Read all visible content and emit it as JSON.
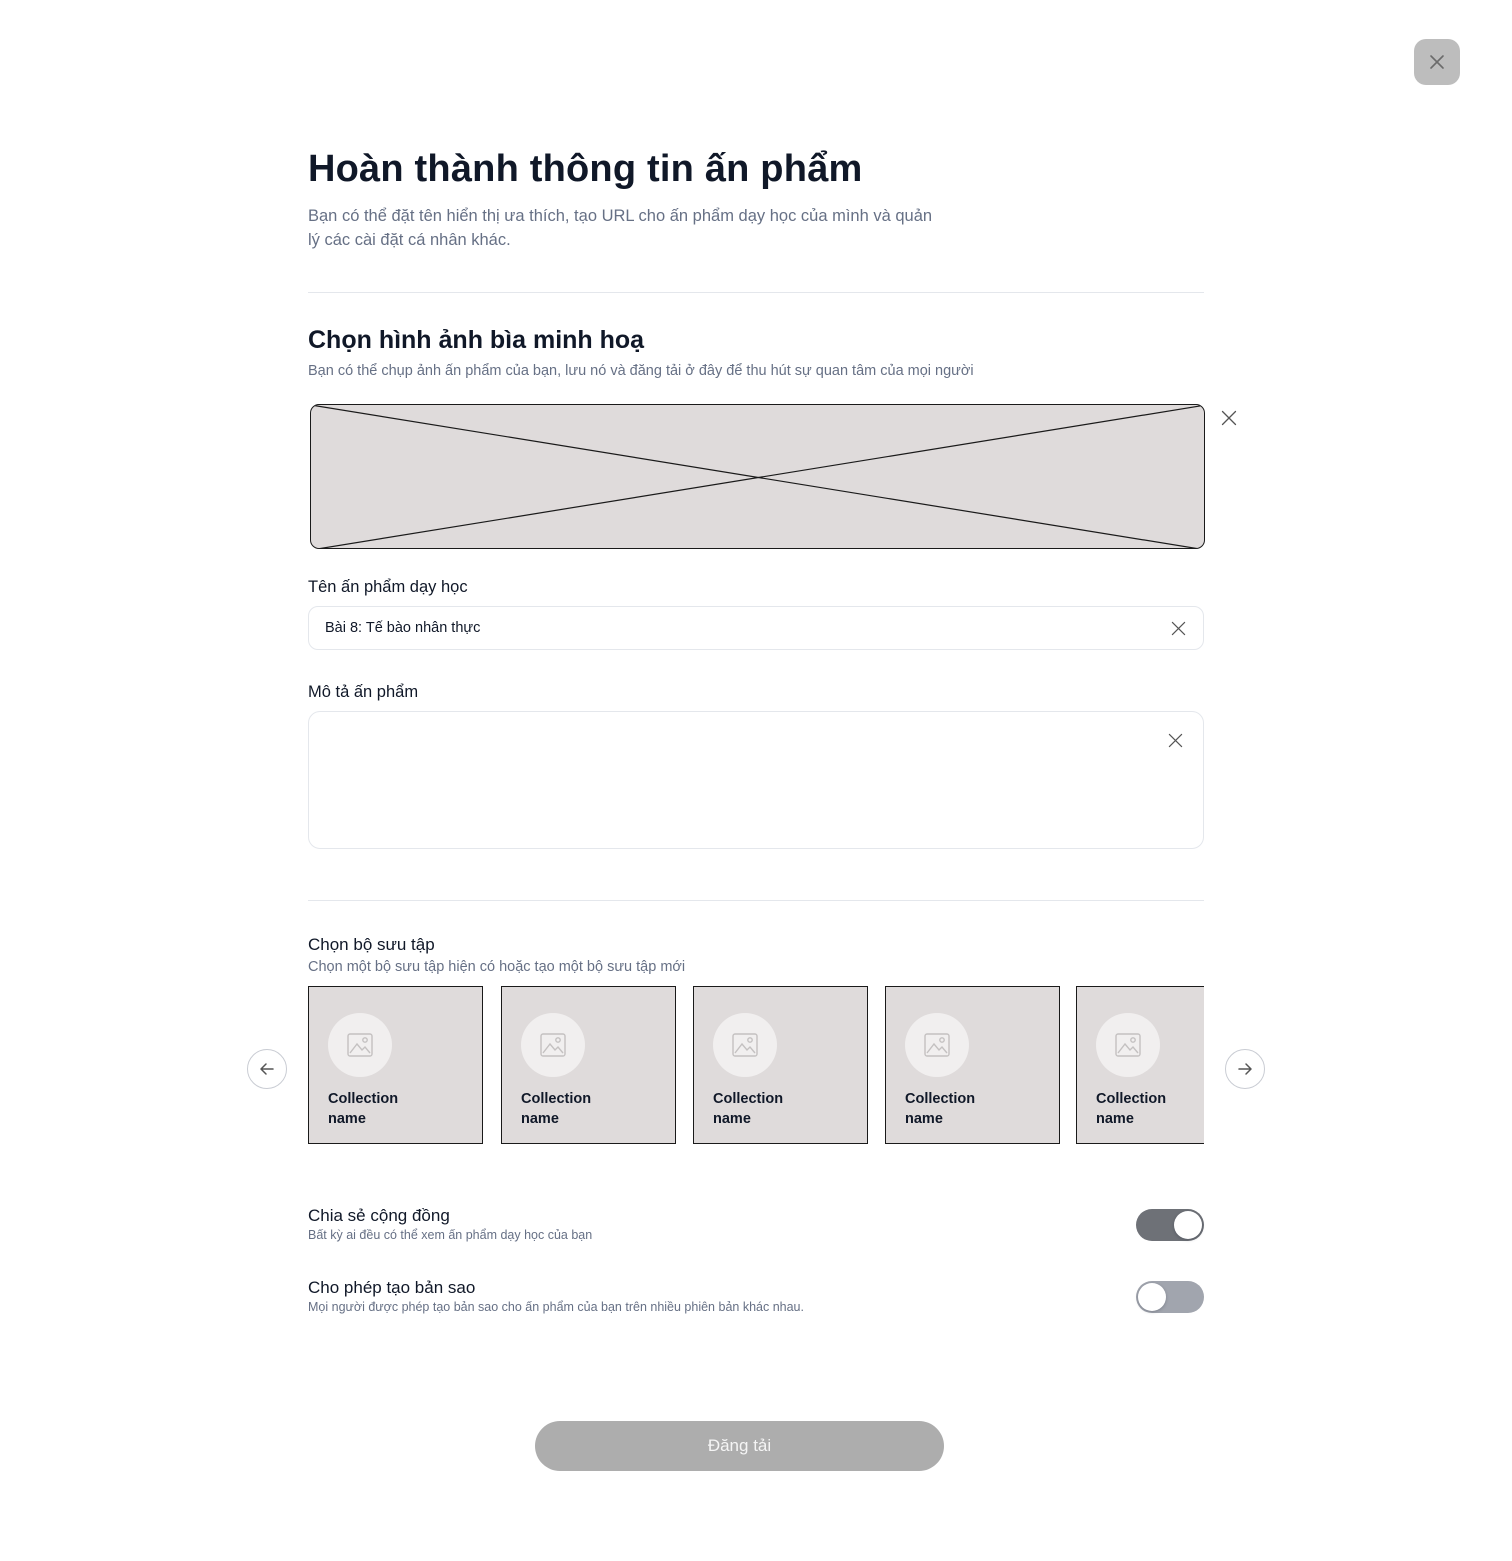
{
  "header": {
    "title": "Hoàn thành thông tin ấn phẩm",
    "subtitle": "Bạn có thể đặt tên hiển thị ưa thích, tạo URL cho ấn phẩm dạy học của mình và quản lý các cài đặt cá nhân khác."
  },
  "close_icon": "close-icon",
  "cover": {
    "title": "Chọn hình ảnh bìa minh hoạ",
    "description": "Bạn có thể chụp ảnh ấn phẩm của bạn, lưu nó và đăng tải ở đây để thu hút sự quan tâm của mọi người"
  },
  "form": {
    "name_label": "Tên ấn phẩm dạy học",
    "name_value": "Bài 8: Tế bào nhân thực",
    "description_label": "Mô tả ấn phẩm",
    "description_value": ""
  },
  "collections": {
    "title": "Chọn bộ sưu tập",
    "description": "Chọn một bộ sưu tập hiện có hoặc tạo một bộ sưu tập mới",
    "items": [
      {
        "name": "Collection name"
      },
      {
        "name": "Collection name"
      },
      {
        "name": "Collection name"
      },
      {
        "name": "Collection name"
      },
      {
        "name": "Collection name"
      }
    ]
  },
  "settings": {
    "community": {
      "title": "Chia sẻ cộng đồng",
      "description": "Bất kỳ ai đều có thể xem ấn phẩm dạy học của bạn",
      "enabled": true
    },
    "copy": {
      "title": "Cho phép tạo bản sao",
      "description": "Mọi người được phép tạo bản sao cho ấn phẩm của bạn trên nhiều phiên bản khác nhau.",
      "enabled": false
    }
  },
  "submit": {
    "label": "Đăng tải"
  },
  "colors": {
    "toggle_on": "#6e7177",
    "toggle_off": "#a1a5ae",
    "submit_bg": "#adadad",
    "placeholder_bg": "#dfdbdb"
  }
}
